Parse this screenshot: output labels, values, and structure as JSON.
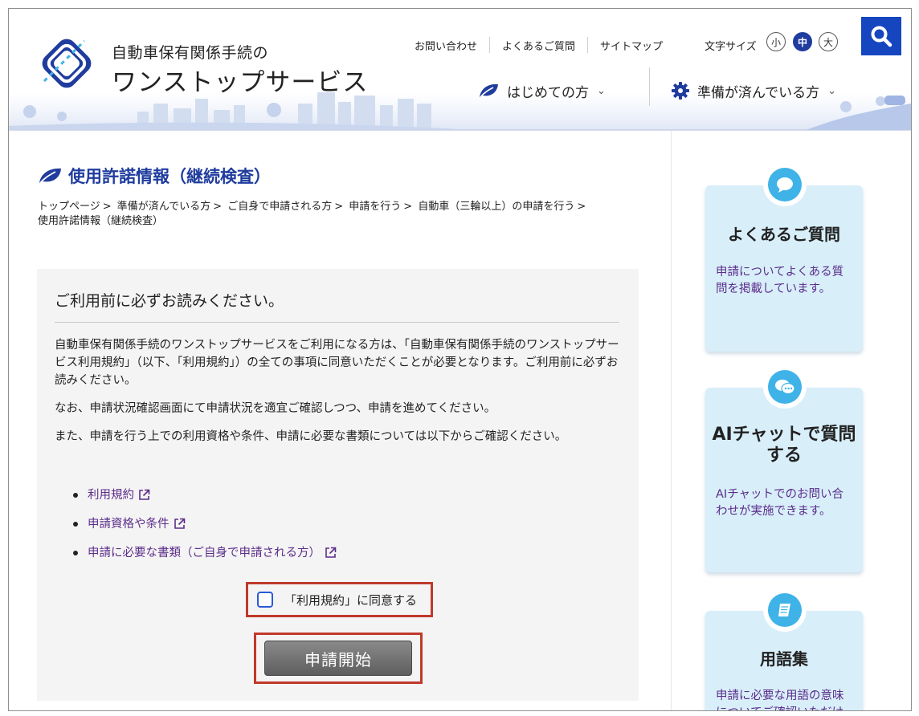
{
  "site": {
    "title_line1": "自動車保有関係手続の",
    "title_line2": "ワンストップサービス"
  },
  "utility_nav": {
    "contact": "お問い合わせ",
    "faq": "よくあるご質問",
    "sitemap": "サイトマップ"
  },
  "font_size": {
    "label": "文字サイズ",
    "small": "小",
    "medium": "中",
    "large": "大",
    "selected": "中"
  },
  "main_nav": {
    "beginners": "はじめての方",
    "prepared": "準備が済んでいる方"
  },
  "page": {
    "title": "使用許諾情報（継続検査）",
    "breadcrumb": [
      "トップページ",
      "準備が済んでいる方",
      "ご自身で申請される方",
      "申請を行う",
      "自動車（三輪以上）の申請を行う",
      "使用許諾情報（継続検査）"
    ],
    "breadcrumb_separator": ">"
  },
  "notice": {
    "heading": "ご利用前に必ずお読みください。",
    "paragraph1": "自動車保有関係手続のワンストップサービスをご利用になる方は、「自動車保有関係手続のワンストップサービス利用規約」（以下、「利用規約」）の全ての事項に同意いただくことが必要となります。ご利用前に必ずお読みください。",
    "paragraph2": "なお、申請状況確認画面にて申請状況を適宜ご確認しつつ、申請を進めてください。",
    "paragraph3": "また、申請を行う上での利用資格や条件、申請に必要な書類については以下からご確認ください。",
    "links": [
      "利用規約",
      "申請資格や条件",
      "申請に必要な書類（ご自身で申請される方）"
    ],
    "agree_label": "「利用規約」に同意する",
    "agree_checked": false,
    "start_button": "申請開始"
  },
  "sidebar": {
    "cards": [
      {
        "title": "よくあるご質問",
        "desc": "申請についてよくある質問を掲載しています。",
        "icon": "speech-bubble-icon"
      },
      {
        "title": "AIチャットで質問する",
        "desc": "AIチャットでのお問い合わせが実施できます。",
        "icon": "chat-bubbles-icon"
      },
      {
        "title": "用語集",
        "desc": "申請に必要な用語の意味についてご確認いただけます。",
        "icon": "book-icon"
      }
    ]
  },
  "colors": {
    "brand_blue": "#1f3c9e",
    "search_blue": "#1546c0",
    "link_purple": "#5b2d8a",
    "highlight_red": "#c0392b",
    "card_bg": "#d8effa",
    "card_icon": "#3fb3e8"
  }
}
